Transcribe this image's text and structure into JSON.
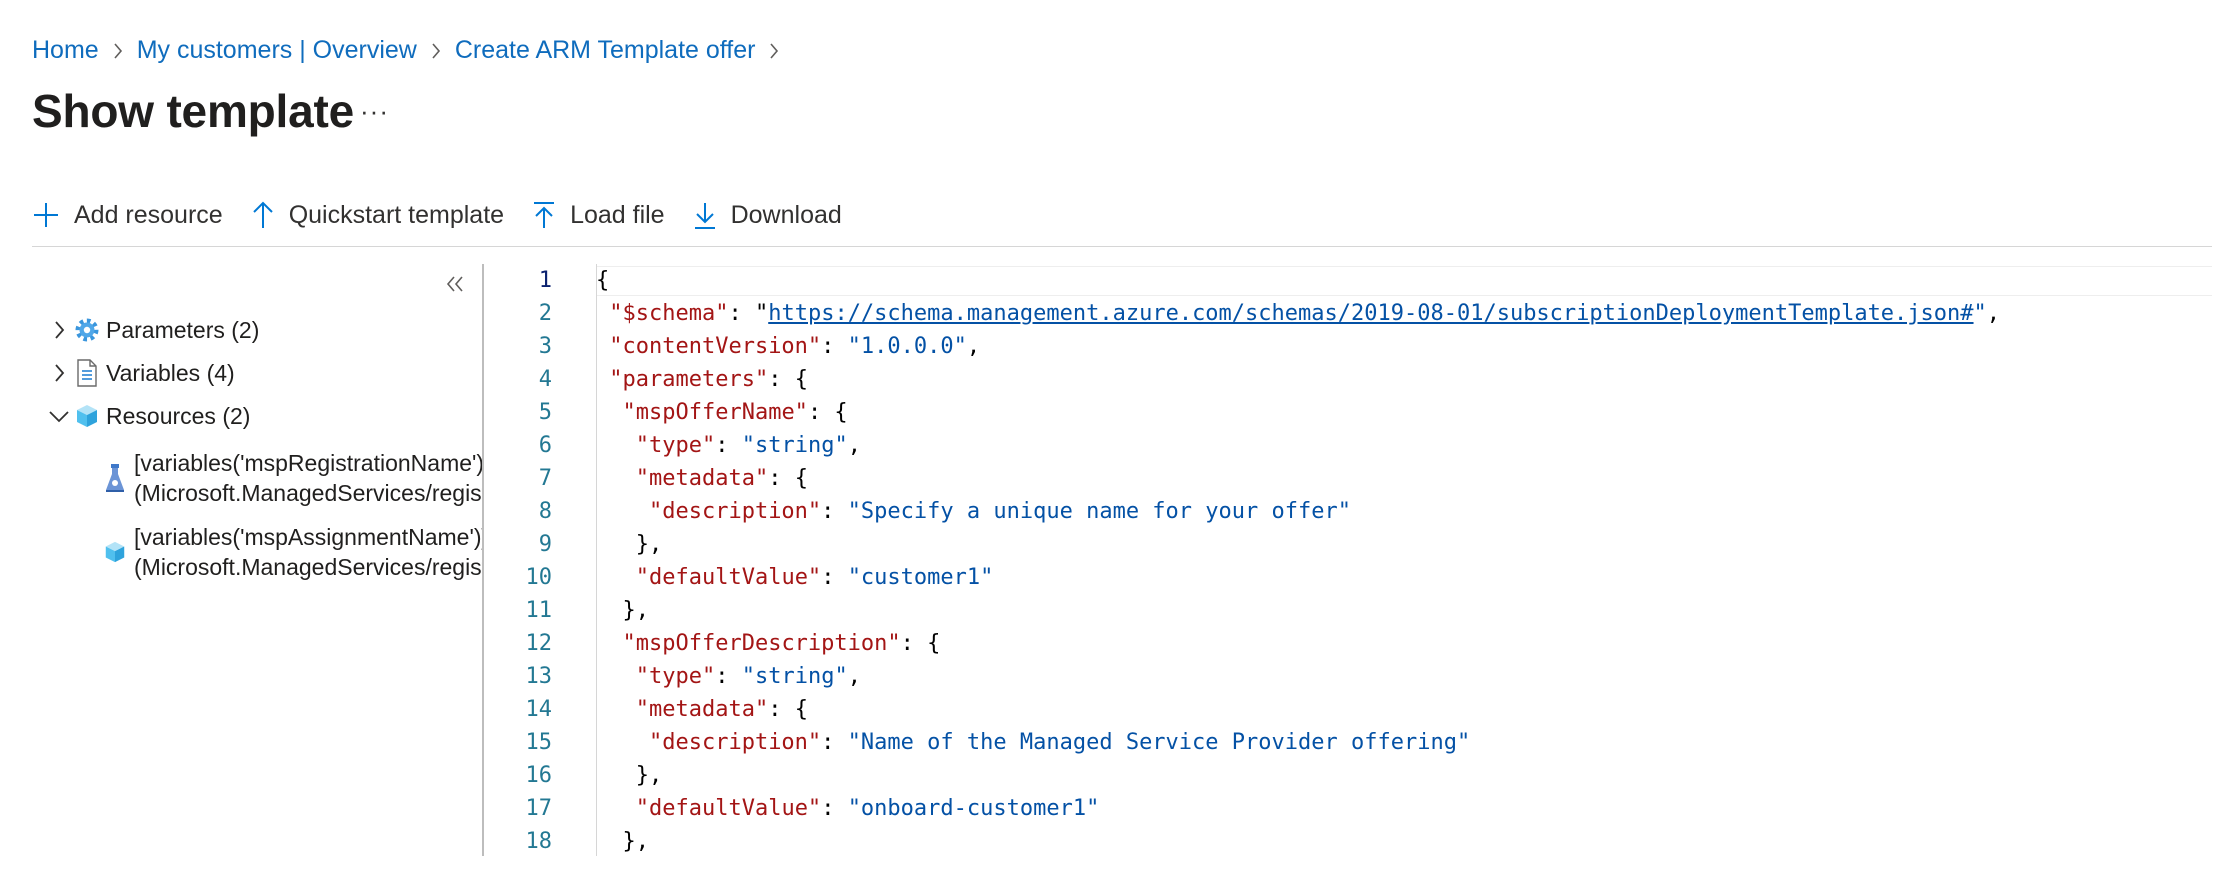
{
  "breadcrumb": {
    "items": [
      "Home",
      "My customers | Overview",
      "Create ARM Template offer"
    ]
  },
  "page": {
    "title": "Show template",
    "more_label": "···"
  },
  "toolbar": {
    "add_resource": "Add resource",
    "quickstart": "Quickstart template",
    "load_file": "Load file",
    "download": "Download"
  },
  "tree": {
    "collapse_label": "«",
    "nodes": [
      {
        "label": "Parameters (2)",
        "icon": "gear-icon",
        "expanded": false
      },
      {
        "label": "Variables (4)",
        "icon": "document-icon",
        "expanded": false
      },
      {
        "label": "Resources (2)",
        "icon": "cube-icon",
        "expanded": true
      }
    ],
    "resources": [
      {
        "line1": "[variables('mspRegistrationName')]",
        "line2": "(Microsoft.ManagedServices/registrationDefinitions)",
        "icon": "registration-icon"
      },
      {
        "line1": "[variables('mspAssignmentName')]",
        "line2": "(Microsoft.ManagedServices/registrationAssignments)",
        "icon": "cube-icon"
      }
    ]
  },
  "editor": {
    "line_numbers": [
      "1",
      "2",
      "3",
      "4",
      "5",
      "6",
      "7",
      "8",
      "9",
      "10",
      "11",
      "12",
      "13",
      "14",
      "15",
      "16",
      "17",
      "18"
    ],
    "lines": [
      [
        {
          "t": "p",
          "v": "{"
        }
      ],
      [
        {
          "t": "p",
          "v": " "
        },
        {
          "t": "k",
          "v": "\"$schema\""
        },
        {
          "t": "p",
          "v": ": \""
        },
        {
          "t": "u",
          "v": "https://schema.management.azure.com/schemas/2019-08-01/subscriptionDeploymentTemplate.json#"
        },
        {
          "t": "s",
          "v": "\""
        },
        {
          "t": "p",
          "v": ","
        }
      ],
      [
        {
          "t": "p",
          "v": " "
        },
        {
          "t": "k",
          "v": "\"contentVersion\""
        },
        {
          "t": "p",
          "v": ": "
        },
        {
          "t": "s",
          "v": "\"1.0.0.0\""
        },
        {
          "t": "p",
          "v": ","
        }
      ],
      [
        {
          "t": "p",
          "v": " "
        },
        {
          "t": "k",
          "v": "\"parameters\""
        },
        {
          "t": "p",
          "v": ": {"
        }
      ],
      [
        {
          "t": "p",
          "v": "  "
        },
        {
          "t": "k",
          "v": "\"mspOfferName\""
        },
        {
          "t": "p",
          "v": ": {"
        }
      ],
      [
        {
          "t": "p",
          "v": "   "
        },
        {
          "t": "k",
          "v": "\"type\""
        },
        {
          "t": "p",
          "v": ": "
        },
        {
          "t": "s",
          "v": "\"string\""
        },
        {
          "t": "p",
          "v": ","
        }
      ],
      [
        {
          "t": "p",
          "v": "   "
        },
        {
          "t": "k",
          "v": "\"metadata\""
        },
        {
          "t": "p",
          "v": ": {"
        }
      ],
      [
        {
          "t": "p",
          "v": "    "
        },
        {
          "t": "k",
          "v": "\"description\""
        },
        {
          "t": "p",
          "v": ": "
        },
        {
          "t": "s",
          "v": "\"Specify a unique name for your offer\""
        }
      ],
      [
        {
          "t": "p",
          "v": "   },"
        }
      ],
      [
        {
          "t": "p",
          "v": "   "
        },
        {
          "t": "k",
          "v": "\"defaultValue\""
        },
        {
          "t": "p",
          "v": ": "
        },
        {
          "t": "s",
          "v": "\"customer1\""
        }
      ],
      [
        {
          "t": "p",
          "v": "  },"
        }
      ],
      [
        {
          "t": "p",
          "v": "  "
        },
        {
          "t": "k",
          "v": "\"mspOfferDescription\""
        },
        {
          "t": "p",
          "v": ": {"
        }
      ],
      [
        {
          "t": "p",
          "v": "   "
        },
        {
          "t": "k",
          "v": "\"type\""
        },
        {
          "t": "p",
          "v": ": "
        },
        {
          "t": "s",
          "v": "\"string\""
        },
        {
          "t": "p",
          "v": ","
        }
      ],
      [
        {
          "t": "p",
          "v": "   "
        },
        {
          "t": "k",
          "v": "\"metadata\""
        },
        {
          "t": "p",
          "v": ": {"
        }
      ],
      [
        {
          "t": "p",
          "v": "    "
        },
        {
          "t": "k",
          "v": "\"description\""
        },
        {
          "t": "p",
          "v": ": "
        },
        {
          "t": "s",
          "v": "\"Name of the Managed Service Provider offering\""
        }
      ],
      [
        {
          "t": "p",
          "v": "   },"
        }
      ],
      [
        {
          "t": "p",
          "v": "   "
        },
        {
          "t": "k",
          "v": "\"defaultValue\""
        },
        {
          "t": "p",
          "v": ": "
        },
        {
          "t": "s",
          "v": "\"onboard-customer1\""
        }
      ],
      [
        {
          "t": "p",
          "v": "  },"
        }
      ]
    ]
  },
  "colors": {
    "link": "#0f6cbd",
    "json_key": "#a31515",
    "json_string": "#0451a5",
    "line_number": "#237893",
    "icon_blue": "#0078d4"
  }
}
